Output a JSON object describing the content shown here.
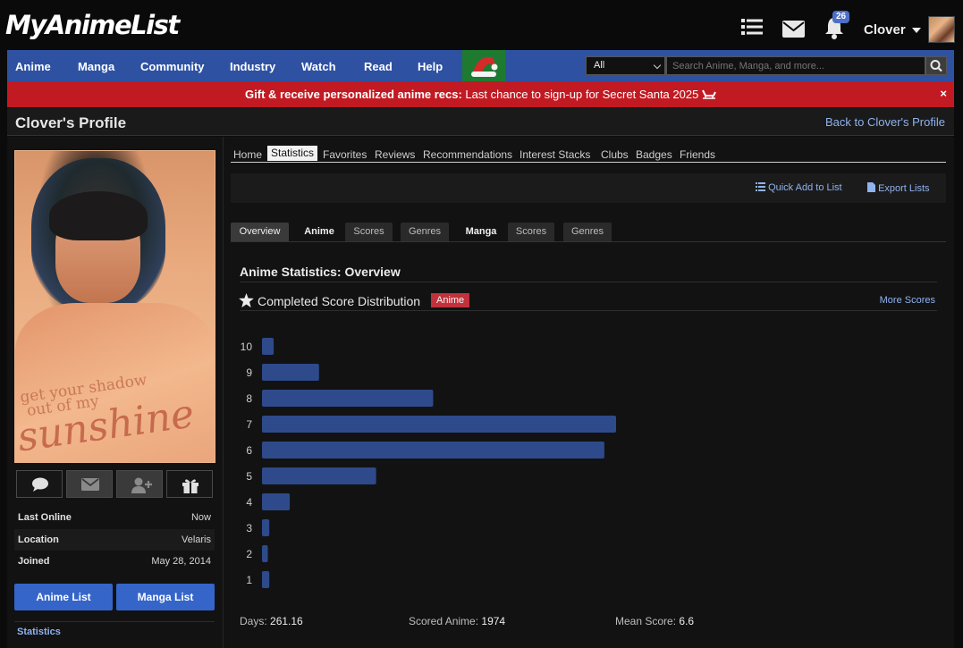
{
  "header": {
    "logo": "MyAnimeList",
    "notification_count": "26",
    "username": "Clover"
  },
  "nav": {
    "items": [
      "Anime",
      "Manga",
      "Community",
      "Industry",
      "Watch",
      "Read",
      "Help"
    ],
    "search_scope": "All",
    "search_placeholder": "Search Anime, Manga, and more..."
  },
  "announcement": {
    "bold": "Gift & receive personalized anime recs:",
    "text": " Last chance to sign-up for Secret Santa 2025",
    "close": "×"
  },
  "page": {
    "title": "Clover's Profile",
    "back_link": "Back to Clover's Profile"
  },
  "profile": {
    "picture_text_small": "get your shadow\n out of my",
    "picture_text_big": "sunshine",
    "info": [
      {
        "key": "Last Online",
        "value": "Now"
      },
      {
        "key": "Location",
        "value": "Velaris"
      },
      {
        "key": "Joined",
        "value": "May 28, 2014"
      }
    ],
    "anime_list_button": "Anime List",
    "manga_list_button": "Manga List",
    "statistics_link": "Statistics"
  },
  "tabs": [
    "Home",
    "Statistics",
    "Favorites",
    "Reviews",
    "Recommendations",
    "Interest Stacks",
    "Clubs",
    "Badges",
    "Friends"
  ],
  "active_tab": "Statistics",
  "toolbar": {
    "quick_add": "Quick Add to List",
    "export": "Export Lists"
  },
  "subtabs": [
    "Overview",
    "Anime",
    "Scores",
    "Genres",
    "Manga",
    "Scores",
    "Genres"
  ],
  "stats": {
    "section_title": "Anime Statistics: Overview",
    "dist_title": "Completed Score Distribution",
    "badge": "Anime",
    "more_scores": "More Scores",
    "days_label": "Days:",
    "days_value": "261.16",
    "scored_label": "Scored Anime:",
    "scored_value": "1974",
    "mean_label": "Mean Score:",
    "mean_value": "6.6"
  },
  "colors": {
    "nav_blue": "#2e51a2",
    "announce_red": "#c21a22",
    "bar_color": "#2e4a8b",
    "link_blue": "#8fb3ee",
    "badge_red": "#c3313b"
  },
  "chart_data": {
    "type": "bar",
    "orientation": "horizontal",
    "title": "",
    "categories": [
      "10",
      "9",
      "8",
      "7",
      "6",
      "5",
      "4",
      "3",
      "2",
      "1"
    ],
    "values": [
      8,
      39,
      117,
      242,
      234,
      78,
      19,
      5,
      4,
      5
    ],
    "note_units": "relative bar length (counts not labeled)"
  }
}
